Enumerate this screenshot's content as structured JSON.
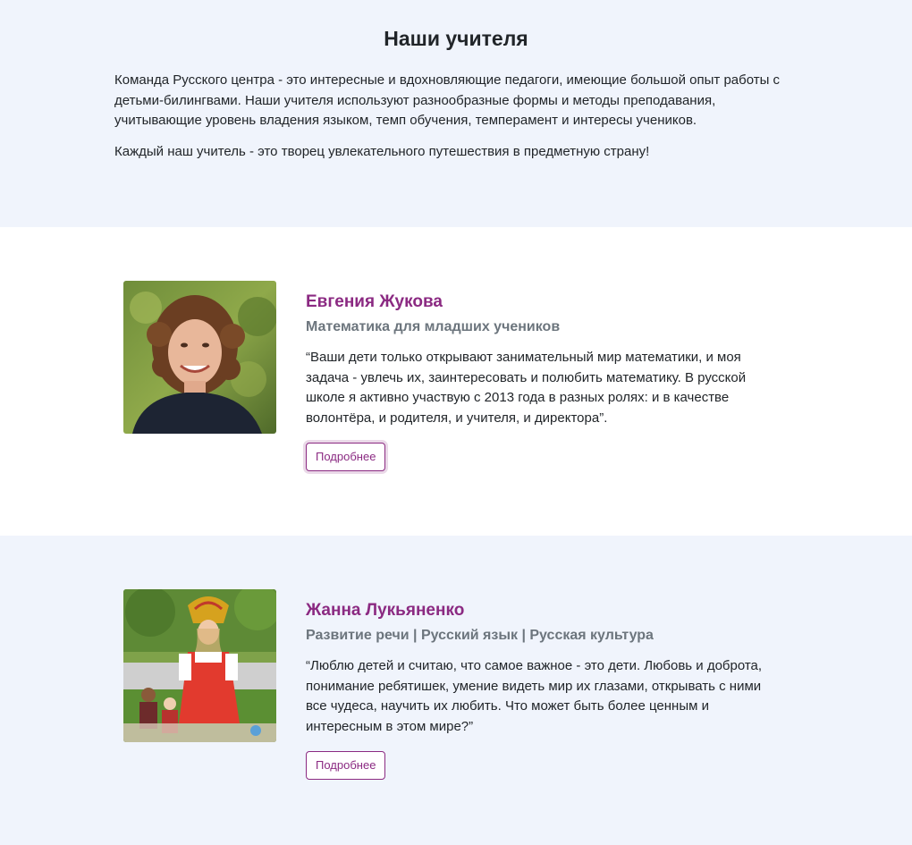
{
  "intro": {
    "title": "Наши учителя",
    "paragraph1": "Команда Русского центра - это интересные и вдохновляющие педагоги, имеющие большой опыт работы с детьми-билингвами. Наши учителя используют разнообразные формы и методы преподавания, учитывающие уровень владения языком, темп обучения, темперамент и интересы учеников.",
    "paragraph2": "Каждый наш учитель - это творец увлекательного путешествия в предметную страну!"
  },
  "teachers": [
    {
      "name": "Евгения Жукова",
      "subject": "Математика для младших учеников",
      "quote": "“Ваши дети только открывают занимательный мир математики, и моя задача - увлечь их, заинтересовать и полюбить математику. В русской школе я активно участвую с 2013 года в разных ролях: и в качестве волонтёра, и родителя, и учителя, и директора”.",
      "button": "Подробнее"
    },
    {
      "name": "Жанна Лукьяненко",
      "subject": "Развитие речи | Русский язык | Русская культура",
      "quote": "“Люблю детей и считаю, что самое важное - это дети. Любовь и доброта, понимание ребятишек, умение видеть мир их глазами, открывать с ними все чудеса, научить их любить. Что может быть более ценным и интересным в этом мире?”",
      "button": "Подробнее"
    }
  ],
  "colors": {
    "accent": "#8b2a82",
    "section_bg": "#f0f4fc",
    "subtitle": "#6c757d"
  }
}
